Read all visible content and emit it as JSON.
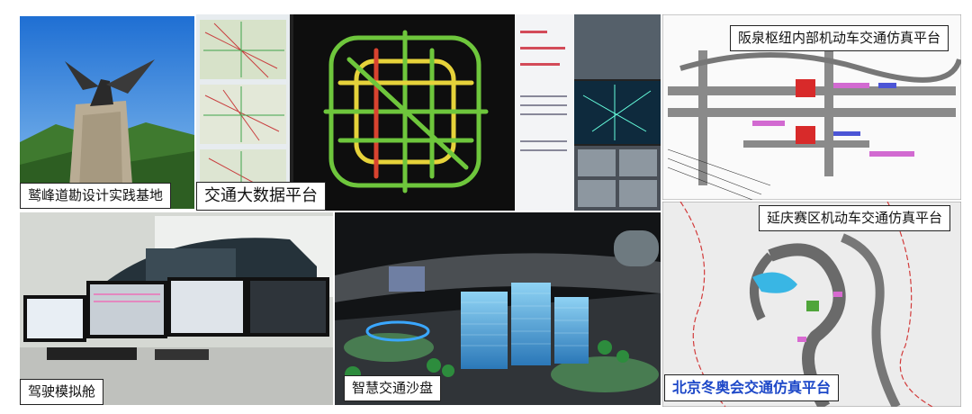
{
  "labels": {
    "eagle_peak": "鹫峰道勘设计实践基地",
    "traffic_big_data": "交通大数据平台",
    "fuquan_hub": "阪泉枢纽内部机动车交通仿真平台",
    "yanqing_zone": "延庆赛区机动车交通仿真平台",
    "driving_simulator": "驾驶模拟舱",
    "smart_sandbox": "智慧交通沙盘",
    "winter_olympics": "北京冬奥会交通仿真平台"
  },
  "colors": {
    "accent_blue": "#1d48c8",
    "sky": "#2f7fd9",
    "road_green": "#6ec63c",
    "road_yellow": "#e6d23a",
    "road_red": "#d8432f",
    "dark_bg": "#1a1a1a"
  }
}
